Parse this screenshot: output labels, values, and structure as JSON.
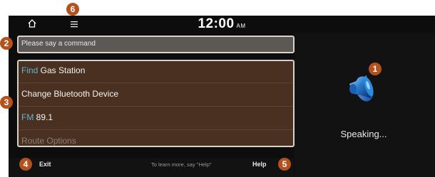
{
  "status_bar": {
    "time": "12:00",
    "ampm": "AM",
    "home_icon": "home-icon",
    "menu_icon": "menu-icon"
  },
  "command_prompt": "Please say a command",
  "command_list": [
    {
      "keyword": "Find",
      "rest": " Gas Station"
    },
    {
      "keyword": "",
      "rest": "Change Bluetooth Device"
    },
    {
      "keyword": "FM",
      "rest": " 89.1"
    },
    {
      "keyword": "",
      "rest": "Route Options"
    }
  ],
  "voice_status": "Speaking...",
  "bottom_bar": {
    "exit_label": "Exit",
    "hint_text": "To learn more, say \"Help\"",
    "help_label": "Help"
  },
  "callouts": [
    "1",
    "2",
    "3",
    "4",
    "5",
    "6"
  ],
  "colors": {
    "badge": "#b4521e",
    "keyword": "#5bb7d6",
    "list_bg": "#4a3020",
    "screen_bg": "#0d0d0d"
  }
}
